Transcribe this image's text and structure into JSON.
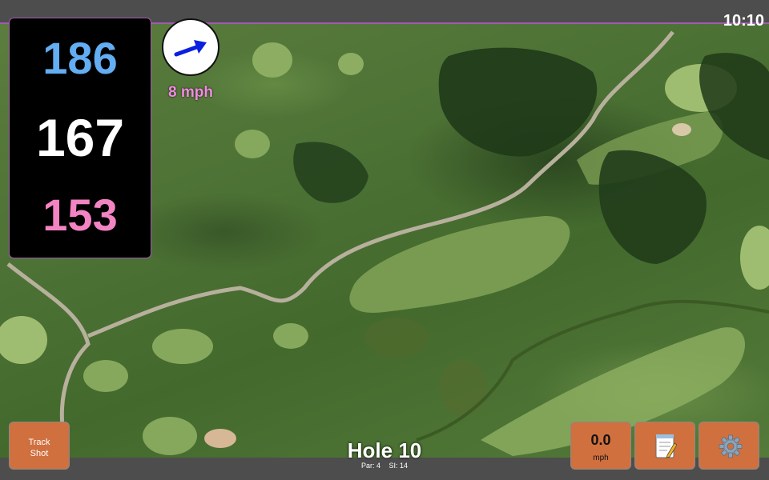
{
  "status": {
    "time": "10:10"
  },
  "distances": {
    "back": "186",
    "center": "167",
    "front": "153"
  },
  "wind": {
    "speed_text": "8 mph",
    "direction_icon": "arrow-icon",
    "arrow_color": "#0a1fe0"
  },
  "hole": {
    "title": "Hole 10",
    "par_label": "Par: 4",
    "si_label": "SI: 14"
  },
  "buttons": {
    "track_shot_label": "Track Shot",
    "speed_value": "0.0",
    "speed_unit": "mph",
    "notes_icon": "notepad-icon",
    "settings_icon": "gear-icon"
  },
  "colors": {
    "back_distance": "#63adf2",
    "center_distance": "#ffffff",
    "front_distance": "#f384c3",
    "button_orange": "#d0703f",
    "wind_text": "#f08be0"
  }
}
